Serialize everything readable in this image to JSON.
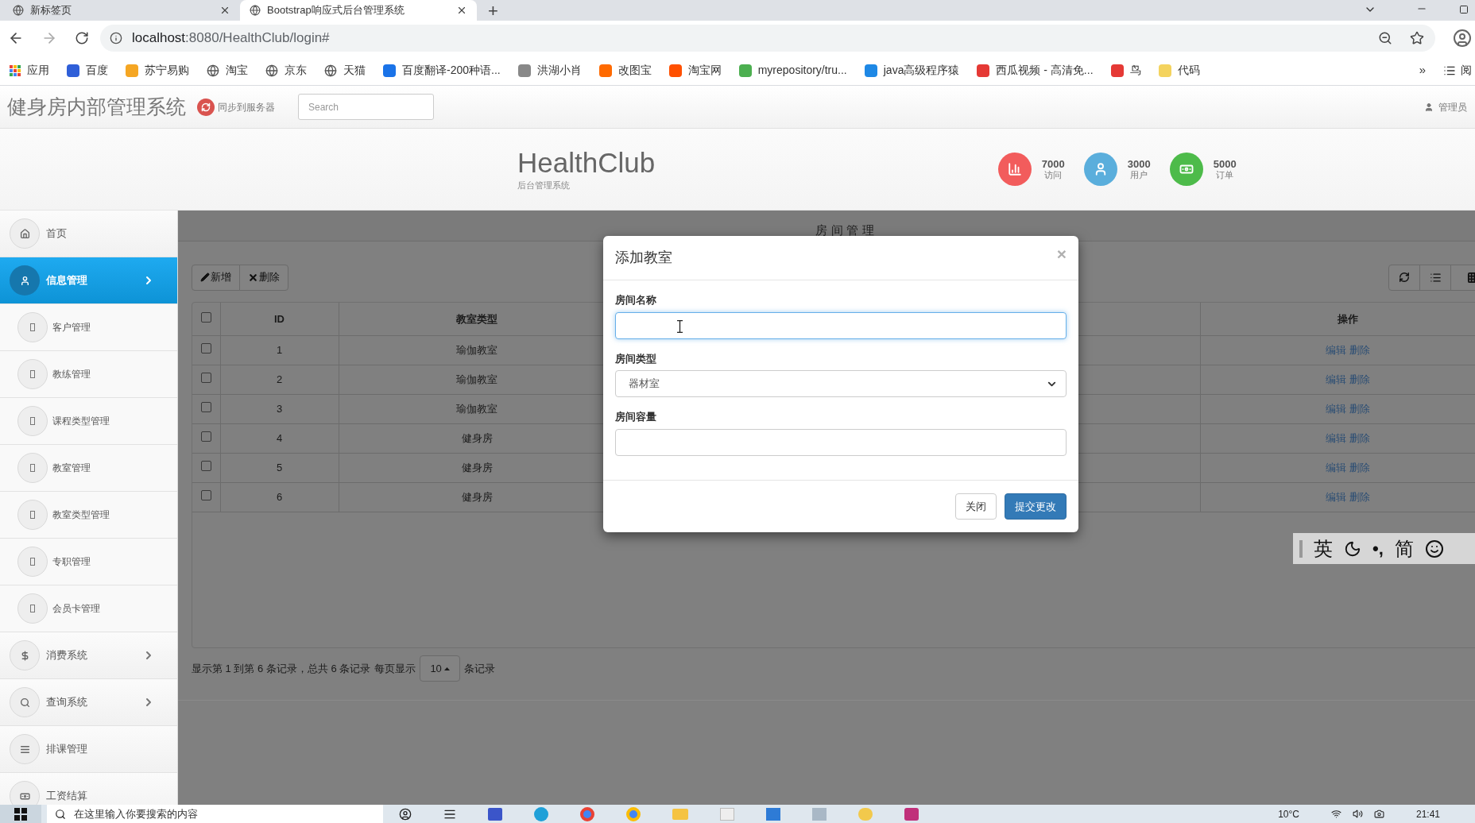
{
  "browser": {
    "tabs": [
      {
        "title": "新标签页",
        "selected": false
      },
      {
        "title": "Bootstrap响应式后台管理系统",
        "selected": true
      }
    ],
    "new_tab": "+",
    "url": {
      "host": "localhost",
      "path": ":8080/HealthClub/login#"
    },
    "bookmarks": [
      "应用",
      "百度",
      "苏宁易购",
      "淘宝",
      "京东",
      "天猫",
      "百度翻译-200种语...",
      "洪湖小肖",
      "改图宝",
      "淘宝网",
      "myrepository/tru...",
      "java高级程序猿",
      "西瓜视频 - 高清免...",
      "鸟",
      "代码"
    ],
    "bookmarks_more": "»",
    "reading_list": "阅"
  },
  "navbar": {
    "title": "健身房内部管理系统",
    "sync": "同步到服务器",
    "search_placeholder": "Search",
    "user": "管理员"
  },
  "header": {
    "brand": "HealthClub",
    "subtitle": "后台管理系统",
    "stats": [
      {
        "value": "7000",
        "label": "访问",
        "color": "#f25c5c"
      },
      {
        "value": "3000",
        "label": "用户",
        "color": "#5aaedc"
      },
      {
        "value": "5000",
        "label": "订单",
        "color": "#4dbb4a"
      }
    ]
  },
  "sidebar": {
    "items": [
      {
        "label": "首页",
        "selected": false,
        "expandable": false
      },
      {
        "label": "信息管理",
        "selected": true,
        "expandable": true,
        "children": [
          {
            "label": "客户管理",
            "selected": false
          },
          {
            "label": "教练管理",
            "selected": false
          },
          {
            "label": "课程类型管理",
            "selected": false
          },
          {
            "label": "教室管理",
            "selected": false
          },
          {
            "label": "教室类型管理",
            "selected": false
          },
          {
            "label": "专职管理",
            "selected": false
          },
          {
            "label": "会员卡管理",
            "selected": false
          }
        ]
      },
      {
        "label": "消费系统",
        "selected": false,
        "expandable": true
      },
      {
        "label": "查询系统",
        "selected": false,
        "expandable": true
      },
      {
        "label": "排课管理",
        "selected": false,
        "expandable": false
      },
      {
        "label": "工资结算",
        "selected": false,
        "expandable": false
      }
    ]
  },
  "page": {
    "title": "房间管理",
    "toolbar": [
      "新增",
      "删除"
    ],
    "table": {
      "select_all_checked": false,
      "columns": [
        "ID",
        "教室类型",
        "操作"
      ],
      "rows": [
        {
          "checked": false,
          "id": "1",
          "type": "瑜伽教室",
          "actions": [
            "编辑",
            "删除"
          ]
        },
        {
          "checked": false,
          "id": "2",
          "type": "瑜伽教室",
          "actions": [
            "编辑",
            "删除"
          ]
        },
        {
          "checked": false,
          "id": "3",
          "type": "瑜伽教室",
          "actions": [
            "编辑",
            "删除"
          ]
        },
        {
          "checked": false,
          "id": "4",
          "type": "健身房",
          "actions": [
            "编辑",
            "删除"
          ]
        },
        {
          "checked": false,
          "id": "5",
          "type": "健身房",
          "actions": [
            "编辑",
            "删除"
          ]
        },
        {
          "checked": false,
          "id": "6",
          "type": "健身房",
          "actions": [
            "编辑",
            "删除"
          ]
        }
      ]
    },
    "pagination": {
      "summary": "显示第 1 到第 6 条记录，总共 6 条记录",
      "per_page_label": "每页显示",
      "page_size": "10",
      "suffix": "条记录"
    }
  },
  "modal": {
    "title": "添加教室",
    "close": "×",
    "fields": [
      {
        "label": "房间名称",
        "kind": "text",
        "focused": true
      },
      {
        "label": "房间类型",
        "kind": "select",
        "value": "器材室"
      },
      {
        "label": "房间容量",
        "kind": "text",
        "focused": false
      }
    ],
    "buttons": [
      {
        "label": "关闭",
        "kind": "default"
      },
      {
        "label": "提交更改",
        "kind": "primary"
      }
    ]
  },
  "ime": {
    "labels": [
      "英",
      "•,",
      "简"
    ]
  },
  "taskbar": {
    "search_placeholder": "在这里输入你要搜索的内容",
    "weather": "10°C",
    "time": "21:41"
  }
}
